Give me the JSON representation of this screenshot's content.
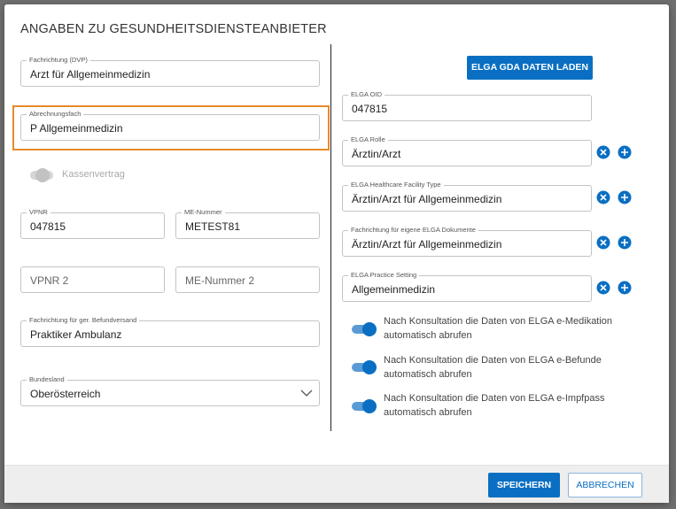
{
  "dialog": {
    "title": "ANGABEN ZU GESUNDHEITSDIENSTEANBIETER"
  },
  "left": {
    "fachrichtung_dvp": {
      "label": "Fachrichtung (DVP)",
      "value": "Arzt für Allgemeinmedizin"
    },
    "abrechnungsfach": {
      "label": "Abrechnungsfach",
      "value": "P Allgemeinmedizin"
    },
    "kassenvertrag": {
      "label": "Kassenvertrag",
      "on": false
    },
    "vpnr": {
      "label": "VPNR",
      "value": "047815"
    },
    "me_nummer": {
      "label": "ME-Nummer",
      "value": "METEST81"
    },
    "vpnr2": {
      "placeholder": "VPNR 2"
    },
    "me_nummer2": {
      "placeholder": "ME-Nummer 2"
    },
    "fachrichtung_befund": {
      "label": "Fachrichtung für ger. Befundversand",
      "value": "Praktiker Ambulanz"
    },
    "bundesland": {
      "label": "Bundesland",
      "value": "Oberösterreich"
    }
  },
  "right": {
    "load_button": "ELGA GDA DATEN LADEN",
    "elga_oid": {
      "label": "ELGA OID",
      "value": "047815"
    },
    "elga_rolle": {
      "label": "ELGA Rolle",
      "value": "Ärztin/Arzt"
    },
    "facility_type": {
      "label": "ELGA Healthcare Facility Type",
      "value": "Ärztin/Arzt für Allgemeinmedizin"
    },
    "fachrichtung_dok": {
      "label": "Fachrichtung für eigene ELGA Dokumente",
      "value": "Ärztin/Arzt für Allgemeinmedizin"
    },
    "practice_setting": {
      "label": "ELGA Practice Setting",
      "value": "Allgemeinmedizin"
    },
    "toggles": [
      {
        "line1": "Nach Konsultation die Daten von ELGA e-Medikation",
        "line2": "automatisch abrufen",
        "on": true
      },
      {
        "line1": "Nach Konsultation die Daten von ELGA e-Befunde",
        "line2": "automatisch abrufen",
        "on": true
      },
      {
        "line1": "Nach Konsultation die Daten von ELGA e-Impfpass",
        "line2": "automatisch abrufen",
        "on": true
      }
    ]
  },
  "footer": {
    "save_label": "SPEICHERN",
    "cancel_label": "ABBRECHEN"
  },
  "colors": {
    "accent": "#0a6fc2",
    "highlight": "#e8892c"
  },
  "icons": [
    "clear-circle-icon",
    "add-circle-icon",
    "chevron-down-icon"
  ]
}
